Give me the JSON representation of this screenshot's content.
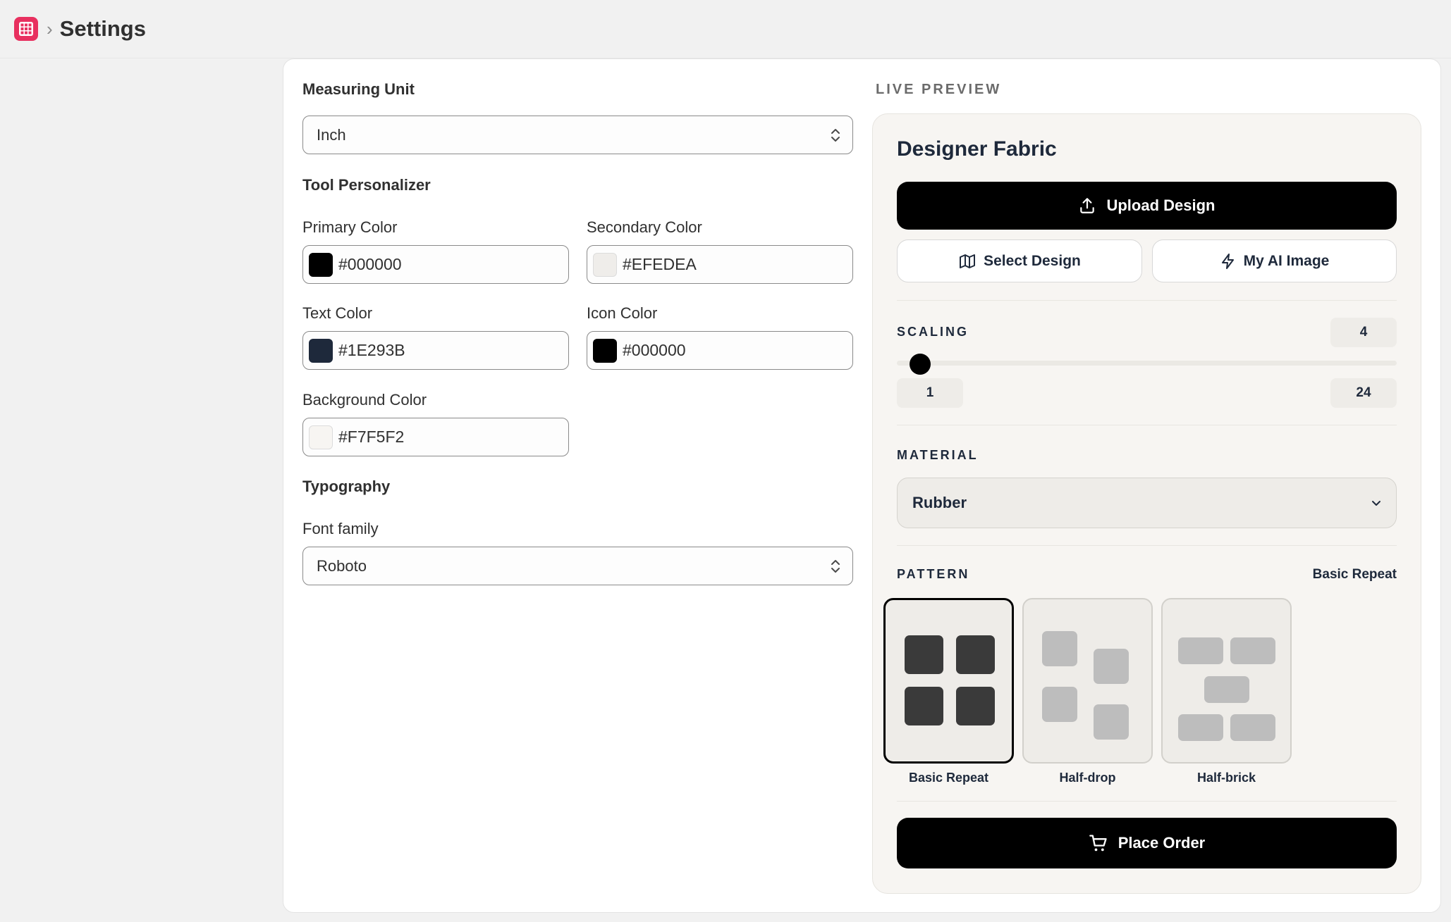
{
  "header": {
    "breadcrumb_app": "app-grid-icon",
    "title": "Settings"
  },
  "settings": {
    "measuring_unit": {
      "label": "Measuring Unit",
      "value": "Inch"
    },
    "tool_personalizer": {
      "heading": "Tool Personalizer",
      "primary": {
        "label": "Primary Color",
        "value": "#000000"
      },
      "secondary": {
        "label": "Secondary Color",
        "value": "#EFEDEA"
      },
      "text": {
        "label": "Text Color",
        "value": "#1E293B"
      },
      "icon": {
        "label": "Icon Color",
        "value": "#000000"
      },
      "background": {
        "label": "Background Color",
        "value": "#F7F5F2"
      }
    },
    "typography": {
      "heading": "Typography",
      "font_family_label": "Font family",
      "font_family_value": "Roboto"
    }
  },
  "preview": {
    "section_label": "LIVE PREVIEW",
    "title": "Designer Fabric",
    "upload_button": "Upload Design",
    "select_design_button": "Select Design",
    "ai_image_button": "My AI Image",
    "scaling": {
      "label": "SCALING",
      "value": "4",
      "min": "1",
      "max": "24",
      "level": 4
    },
    "material": {
      "label": "MATERIAL",
      "value": "Rubber"
    },
    "pattern": {
      "label": "PATTERN",
      "selected": "Basic Repeat",
      "options": [
        "Basic Repeat",
        "Half-drop",
        "Half-brick"
      ]
    },
    "order_button": "Place Order"
  },
  "colors": {
    "accent": "#E8305F",
    "swatch_primary": "#000000",
    "swatch_secondary": "#EFEDEA",
    "swatch_text": "#1E293B",
    "swatch_icon": "#000000",
    "swatch_background": "#F7F5F2"
  }
}
